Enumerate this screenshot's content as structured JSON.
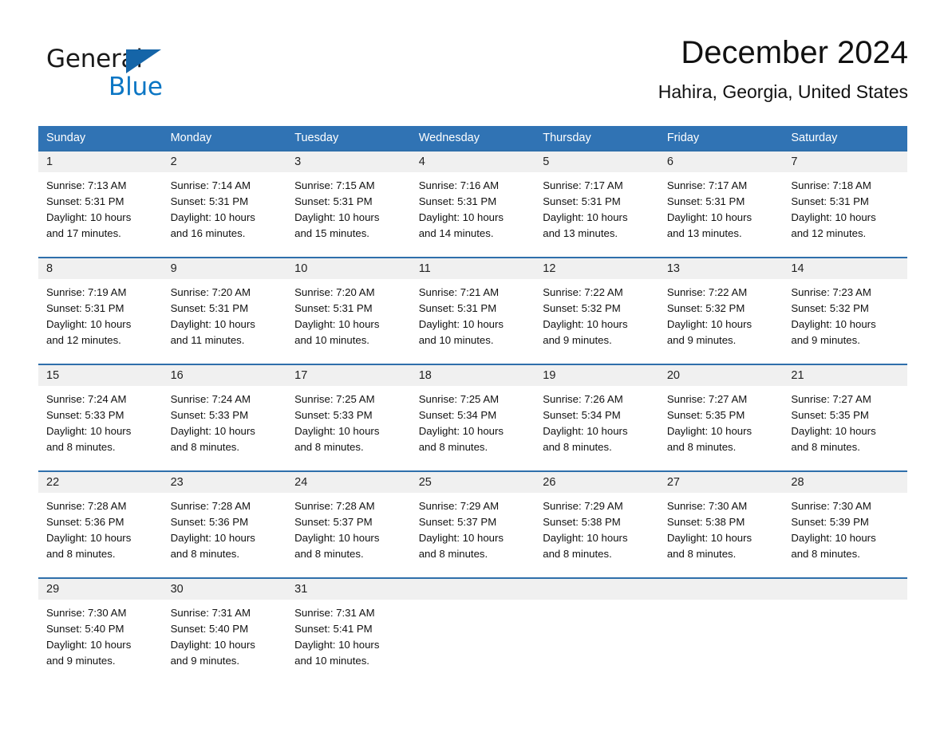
{
  "brand": {
    "name_part1": "General",
    "name_part2": "Blue",
    "triangle_color": "#1565a8",
    "blue_color": "#0b76c4"
  },
  "header": {
    "month_title": "December 2024",
    "location": "Hahira, Georgia, United States"
  },
  "theme": {
    "header_bg": "#3073b4",
    "row_divider": "#2f6fab",
    "date_band_bg": "#f0f0f0",
    "text": "#111111"
  },
  "weekdays": [
    "Sunday",
    "Monday",
    "Tuesday",
    "Wednesday",
    "Thursday",
    "Friday",
    "Saturday"
  ],
  "weeks": [
    [
      {
        "day": "1",
        "sunrise": "Sunrise: 7:13 AM",
        "sunset": "Sunset: 5:31 PM",
        "daylight1": "Daylight: 10 hours",
        "daylight2": "and 17 minutes."
      },
      {
        "day": "2",
        "sunrise": "Sunrise: 7:14 AM",
        "sunset": "Sunset: 5:31 PM",
        "daylight1": "Daylight: 10 hours",
        "daylight2": "and 16 minutes."
      },
      {
        "day": "3",
        "sunrise": "Sunrise: 7:15 AM",
        "sunset": "Sunset: 5:31 PM",
        "daylight1": "Daylight: 10 hours",
        "daylight2": "and 15 minutes."
      },
      {
        "day": "4",
        "sunrise": "Sunrise: 7:16 AM",
        "sunset": "Sunset: 5:31 PM",
        "daylight1": "Daylight: 10 hours",
        "daylight2": "and 14 minutes."
      },
      {
        "day": "5",
        "sunrise": "Sunrise: 7:17 AM",
        "sunset": "Sunset: 5:31 PM",
        "daylight1": "Daylight: 10 hours",
        "daylight2": "and 13 minutes."
      },
      {
        "day": "6",
        "sunrise": "Sunrise: 7:17 AM",
        "sunset": "Sunset: 5:31 PM",
        "daylight1": "Daylight: 10 hours",
        "daylight2": "and 13 minutes."
      },
      {
        "day": "7",
        "sunrise": "Sunrise: 7:18 AM",
        "sunset": "Sunset: 5:31 PM",
        "daylight1": "Daylight: 10 hours",
        "daylight2": "and 12 minutes."
      }
    ],
    [
      {
        "day": "8",
        "sunrise": "Sunrise: 7:19 AM",
        "sunset": "Sunset: 5:31 PM",
        "daylight1": "Daylight: 10 hours",
        "daylight2": "and 12 minutes."
      },
      {
        "day": "9",
        "sunrise": "Sunrise: 7:20 AM",
        "sunset": "Sunset: 5:31 PM",
        "daylight1": "Daylight: 10 hours",
        "daylight2": "and 11 minutes."
      },
      {
        "day": "10",
        "sunrise": "Sunrise: 7:20 AM",
        "sunset": "Sunset: 5:31 PM",
        "daylight1": "Daylight: 10 hours",
        "daylight2": "and 10 minutes."
      },
      {
        "day": "11",
        "sunrise": "Sunrise: 7:21 AM",
        "sunset": "Sunset: 5:31 PM",
        "daylight1": "Daylight: 10 hours",
        "daylight2": "and 10 minutes."
      },
      {
        "day": "12",
        "sunrise": "Sunrise: 7:22 AM",
        "sunset": "Sunset: 5:32 PM",
        "daylight1": "Daylight: 10 hours",
        "daylight2": "and 9 minutes."
      },
      {
        "day": "13",
        "sunrise": "Sunrise: 7:22 AM",
        "sunset": "Sunset: 5:32 PM",
        "daylight1": "Daylight: 10 hours",
        "daylight2": "and 9 minutes."
      },
      {
        "day": "14",
        "sunrise": "Sunrise: 7:23 AM",
        "sunset": "Sunset: 5:32 PM",
        "daylight1": "Daylight: 10 hours",
        "daylight2": "and 9 minutes."
      }
    ],
    [
      {
        "day": "15",
        "sunrise": "Sunrise: 7:24 AM",
        "sunset": "Sunset: 5:33 PM",
        "daylight1": "Daylight: 10 hours",
        "daylight2": "and 8 minutes."
      },
      {
        "day": "16",
        "sunrise": "Sunrise: 7:24 AM",
        "sunset": "Sunset: 5:33 PM",
        "daylight1": "Daylight: 10 hours",
        "daylight2": "and 8 minutes."
      },
      {
        "day": "17",
        "sunrise": "Sunrise: 7:25 AM",
        "sunset": "Sunset: 5:33 PM",
        "daylight1": "Daylight: 10 hours",
        "daylight2": "and 8 minutes."
      },
      {
        "day": "18",
        "sunrise": "Sunrise: 7:25 AM",
        "sunset": "Sunset: 5:34 PM",
        "daylight1": "Daylight: 10 hours",
        "daylight2": "and 8 minutes."
      },
      {
        "day": "19",
        "sunrise": "Sunrise: 7:26 AM",
        "sunset": "Sunset: 5:34 PM",
        "daylight1": "Daylight: 10 hours",
        "daylight2": "and 8 minutes."
      },
      {
        "day": "20",
        "sunrise": "Sunrise: 7:27 AM",
        "sunset": "Sunset: 5:35 PM",
        "daylight1": "Daylight: 10 hours",
        "daylight2": "and 8 minutes."
      },
      {
        "day": "21",
        "sunrise": "Sunrise: 7:27 AM",
        "sunset": "Sunset: 5:35 PM",
        "daylight1": "Daylight: 10 hours",
        "daylight2": "and 8 minutes."
      }
    ],
    [
      {
        "day": "22",
        "sunrise": "Sunrise: 7:28 AM",
        "sunset": "Sunset: 5:36 PM",
        "daylight1": "Daylight: 10 hours",
        "daylight2": "and 8 minutes."
      },
      {
        "day": "23",
        "sunrise": "Sunrise: 7:28 AM",
        "sunset": "Sunset: 5:36 PM",
        "daylight1": "Daylight: 10 hours",
        "daylight2": "and 8 minutes."
      },
      {
        "day": "24",
        "sunrise": "Sunrise: 7:28 AM",
        "sunset": "Sunset: 5:37 PM",
        "daylight1": "Daylight: 10 hours",
        "daylight2": "and 8 minutes."
      },
      {
        "day": "25",
        "sunrise": "Sunrise: 7:29 AM",
        "sunset": "Sunset: 5:37 PM",
        "daylight1": "Daylight: 10 hours",
        "daylight2": "and 8 minutes."
      },
      {
        "day": "26",
        "sunrise": "Sunrise: 7:29 AM",
        "sunset": "Sunset: 5:38 PM",
        "daylight1": "Daylight: 10 hours",
        "daylight2": "and 8 minutes."
      },
      {
        "day": "27",
        "sunrise": "Sunrise: 7:30 AM",
        "sunset": "Sunset: 5:38 PM",
        "daylight1": "Daylight: 10 hours",
        "daylight2": "and 8 minutes."
      },
      {
        "day": "28",
        "sunrise": "Sunrise: 7:30 AM",
        "sunset": "Sunset: 5:39 PM",
        "daylight1": "Daylight: 10 hours",
        "daylight2": "and 8 minutes."
      }
    ],
    [
      {
        "day": "29",
        "sunrise": "Sunrise: 7:30 AM",
        "sunset": "Sunset: 5:40 PM",
        "daylight1": "Daylight: 10 hours",
        "daylight2": "and 9 minutes."
      },
      {
        "day": "30",
        "sunrise": "Sunrise: 7:31 AM",
        "sunset": "Sunset: 5:40 PM",
        "daylight1": "Daylight: 10 hours",
        "daylight2": "and 9 minutes."
      },
      {
        "day": "31",
        "sunrise": "Sunrise: 7:31 AM",
        "sunset": "Sunset: 5:41 PM",
        "daylight1": "Daylight: 10 hours",
        "daylight2": "and 10 minutes."
      },
      {
        "day": "",
        "sunrise": "",
        "sunset": "",
        "daylight1": "",
        "daylight2": ""
      },
      {
        "day": "",
        "sunrise": "",
        "sunset": "",
        "daylight1": "",
        "daylight2": ""
      },
      {
        "day": "",
        "sunrise": "",
        "sunset": "",
        "daylight1": "",
        "daylight2": ""
      },
      {
        "day": "",
        "sunrise": "",
        "sunset": "",
        "daylight1": "",
        "daylight2": ""
      }
    ]
  ]
}
